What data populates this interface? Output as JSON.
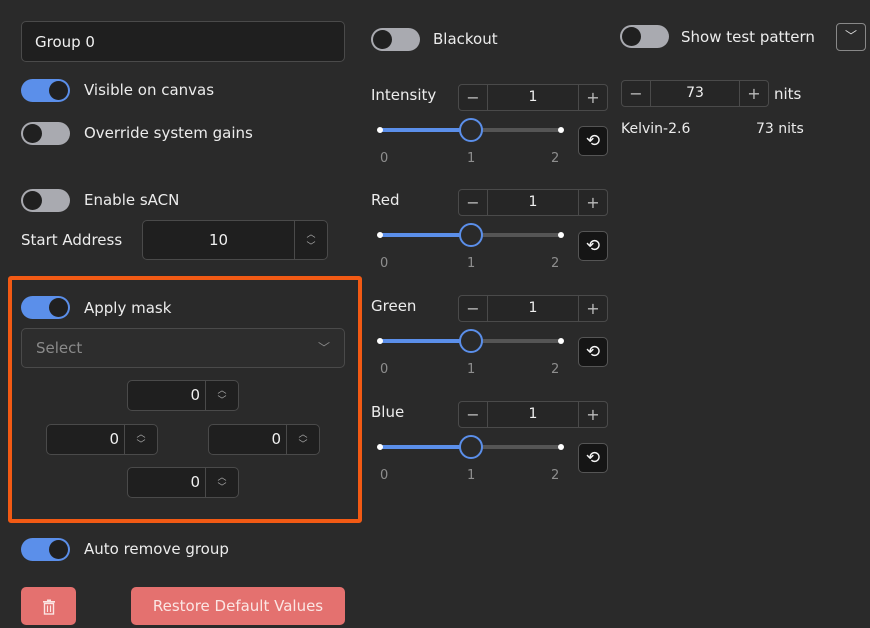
{
  "group_name": "Group 0",
  "toggles": {
    "visible_on_canvas": {
      "label": "Visible on canvas",
      "on": true
    },
    "override_system_gains": {
      "label": "Override system gains",
      "on": false
    },
    "enable_sacn": {
      "label": "Enable sACN",
      "on": false
    },
    "apply_mask": {
      "label": "Apply mask",
      "on": true
    },
    "auto_remove_group": {
      "label": "Auto remove group",
      "on": true
    },
    "blackout": {
      "label": "Blackout",
      "on": false
    },
    "show_test_pattern": {
      "label": "Show test pattern",
      "on": false
    }
  },
  "start_address": {
    "label": "Start Address",
    "value": "10"
  },
  "mask": {
    "select_placeholder": "Select",
    "top": "0",
    "left": "0",
    "right": "0",
    "bottom": "0"
  },
  "sliders": [
    {
      "label": "Intensity",
      "value": "1",
      "min": 0,
      "max": 2,
      "current": 1,
      "ticks": [
        "0",
        "1",
        "2"
      ]
    },
    {
      "label": "Red",
      "value": "1",
      "min": 0,
      "max": 2,
      "current": 1,
      "ticks": [
        "0",
        "1",
        "2"
      ]
    },
    {
      "label": "Green",
      "value": "1",
      "min": 0,
      "max": 2,
      "current": 1,
      "ticks": [
        "0",
        "1",
        "2"
      ]
    },
    {
      "label": "Blue",
      "value": "1",
      "min": 0,
      "max": 2,
      "current": 1,
      "ticks": [
        "0",
        "1",
        "2"
      ]
    }
  ],
  "nits": {
    "value": "73",
    "unit": "nits",
    "profile": "Kelvin-2.6",
    "readout": "73 nits"
  },
  "buttons": {
    "restore": "Restore Default Values",
    "delete_icon": "trash-icon"
  },
  "colors": {
    "accent": "#5b8fea",
    "highlight": "#f25a14",
    "danger": "#e4716f"
  }
}
